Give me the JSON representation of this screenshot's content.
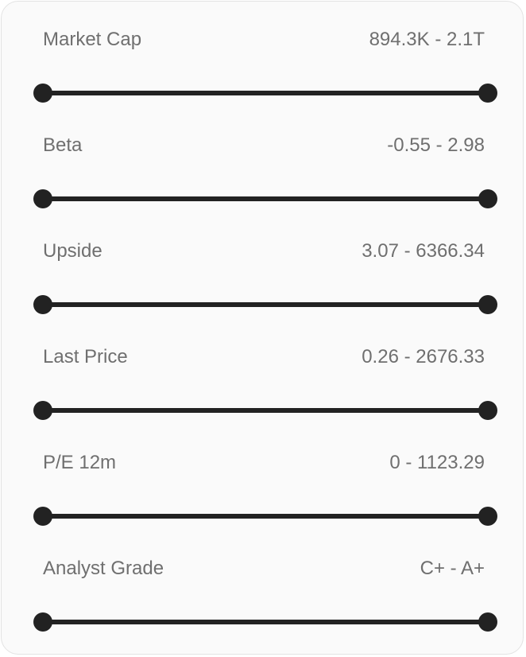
{
  "filters": [
    {
      "label": "Market Cap",
      "range": "894.3K - 2.1T",
      "min_fraction": 0,
      "max_fraction": 1
    },
    {
      "label": "Beta",
      "range": "-0.55 - 2.98",
      "min_fraction": 0,
      "max_fraction": 1
    },
    {
      "label": "Upside",
      "range": "3.07 - 6366.34",
      "min_fraction": 0,
      "max_fraction": 1
    },
    {
      "label": "Last Price",
      "range": "0.26 - 2676.33",
      "min_fraction": 0,
      "max_fraction": 1
    },
    {
      "label": "P/E 12m",
      "range": "0 - 1123.29",
      "min_fraction": 0,
      "max_fraction": 1
    },
    {
      "label": "Analyst Grade",
      "range": "C+ - A+",
      "min_fraction": 0,
      "max_fraction": 1
    }
  ],
  "colors": {
    "track": "#222222",
    "label_text": "#6f6f6f",
    "panel_background": "#fafafa",
    "panel_border": "#e3e3e3"
  }
}
